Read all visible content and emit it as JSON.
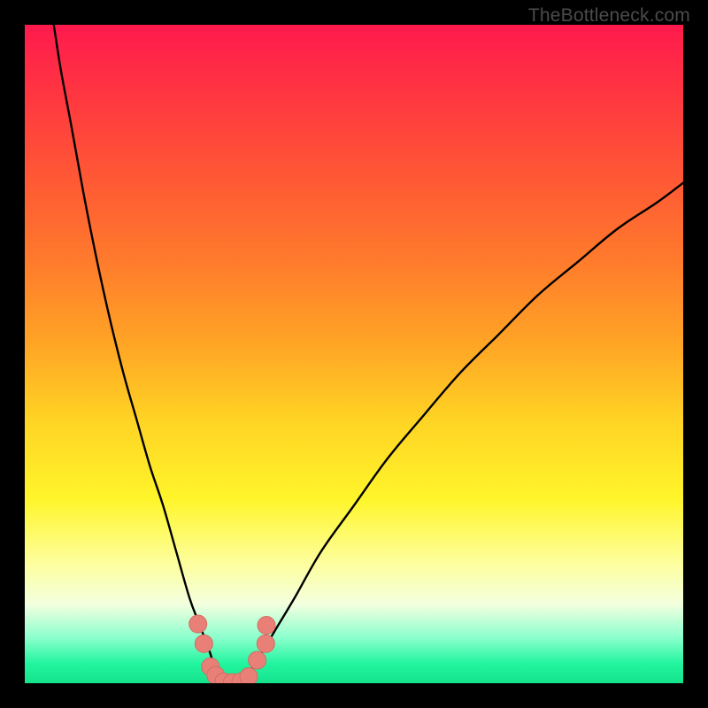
{
  "watermark": "TheBottleneck.com",
  "colors": {
    "frame": "#000000",
    "curve": "#000000",
    "marker_fill": "#e98077",
    "marker_stroke": "#d46b63"
  },
  "chart_data": {
    "type": "line",
    "title": "",
    "xlabel": "",
    "ylabel": "",
    "xlim": [
      0,
      100
    ],
    "ylim": [
      0,
      100
    ],
    "grid": false,
    "legend": false,
    "series": [
      {
        "name": "left-branch",
        "x": [
          4.4,
          5.5,
          7,
          9,
          11,
          13,
          15,
          17,
          19,
          21,
          23,
          25,
          26.5,
          28,
          29,
          30
        ],
        "y": [
          100,
          93,
          85,
          74,
          64,
          55,
          47,
          40,
          33,
          27,
          20,
          13,
          9,
          5,
          2,
          0
        ]
      },
      {
        "name": "right-branch",
        "x": [
          33,
          35,
          38,
          41,
          45,
          50,
          55,
          60,
          66,
          72,
          78,
          84,
          90,
          96,
          100
        ],
        "y": [
          0,
          3,
          8,
          13,
          20,
          27,
          34,
          40,
          47,
          53,
          59,
          64,
          69,
          73,
          76
        ]
      }
    ],
    "markers": [
      {
        "x": 26.3,
        "y": 9.0
      },
      {
        "x": 27.2,
        "y": 6.0
      },
      {
        "x": 28.2,
        "y": 2.5
      },
      {
        "x": 29.0,
        "y": 1.2
      },
      {
        "x": 30.2,
        "y": 0.2
      },
      {
        "x": 31.5,
        "y": 0.1
      },
      {
        "x": 32.8,
        "y": 0.2
      },
      {
        "x": 34.0,
        "y": 1.0
      },
      {
        "x": 35.3,
        "y": 3.5
      },
      {
        "x": 36.6,
        "y": 6.0
      },
      {
        "x": 36.7,
        "y": 8.8
      }
    ],
    "marker_radius_px": 10
  }
}
